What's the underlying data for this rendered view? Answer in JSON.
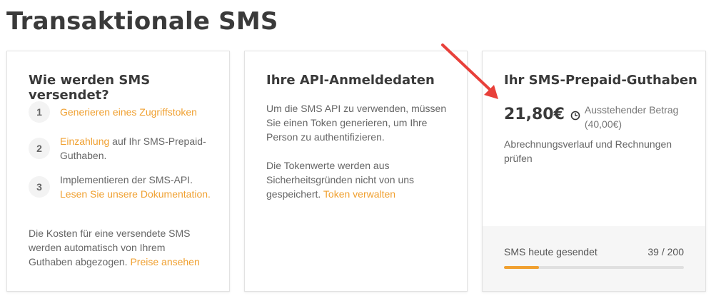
{
  "page": {
    "title": "Transaktionale SMS"
  },
  "card_how": {
    "title": "Wie werden SMS versendet?",
    "steps": [
      {
        "num": "1",
        "link": "Generieren eines Zugriffstoken"
      },
      {
        "num": "2",
        "link": "Einzahlung",
        "text": " auf Ihr SMS-Prepaid-Guthaben."
      },
      {
        "num": "3",
        "text": "Implementieren der SMS-API. ",
        "link": "Lesen Sie unsere Dokumentation."
      }
    ],
    "cost_text": "Die Kosten für eine versendete SMS werden automatisch von Ihrem Guthaben abgezogen. ",
    "cost_link": "Preise ansehen"
  },
  "card_api": {
    "title": "Ihre API-Anmeldedaten",
    "para1": "Um die SMS API zu verwenden, müssen Sie einen Token generieren, um Ihre Person zu authentifizieren.",
    "para2_text": "Die Tokenwerte werden aus Sicherheitsgründen nicht von uns gespeichert. ",
    "para2_link": "Token verwalten"
  },
  "card_balance": {
    "title": "Ihr SMS-Prepaid-Guthaben",
    "amount": "21,80€",
    "pending_label": "Ausstehender Betrag",
    "pending_value": "(40,00€)",
    "history_link": "Abrechnungsverlauf und Rechnungen prüfen",
    "sent_label": "SMS heute gesendet",
    "sent_count": "39 / 200",
    "sent_fraction": 0.195
  },
  "colors": {
    "accent": "#f0a030",
    "arrow": "#e8403a"
  },
  "icons": {
    "pending": "clock-icon",
    "annotation": "red-arrow-icon"
  }
}
